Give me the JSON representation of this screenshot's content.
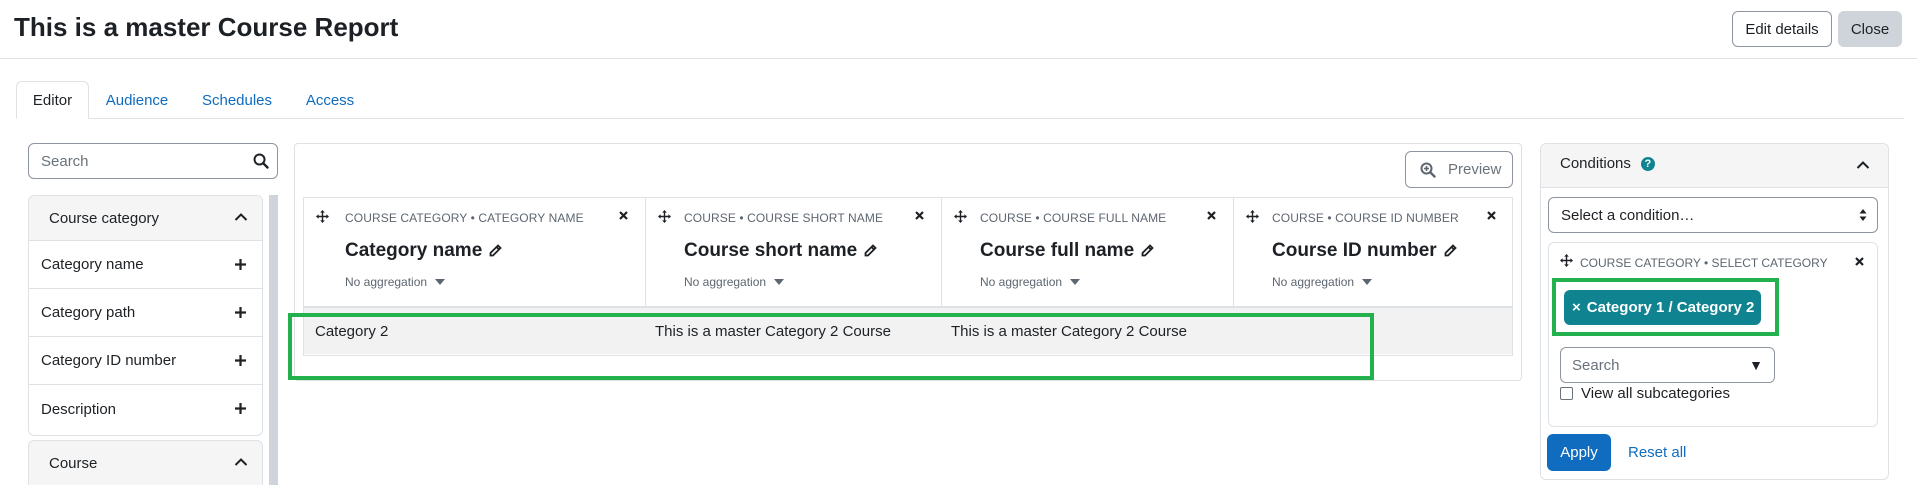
{
  "header": {
    "title": "This is a master Course Report",
    "edit_details_label": "Edit details",
    "close_label": "Close"
  },
  "tabs": [
    {
      "label": "Editor",
      "active": true
    },
    {
      "label": "Audience",
      "active": false
    },
    {
      "label": "Schedules",
      "active": false
    },
    {
      "label": "Access",
      "active": false
    }
  ],
  "sidebar": {
    "search_placeholder": "Search",
    "groups": [
      {
        "title": "Course category",
        "expanded": true,
        "items": [
          {
            "label": "Category name"
          },
          {
            "label": "Category path"
          },
          {
            "label": "Category ID number"
          },
          {
            "label": "Description"
          }
        ]
      },
      {
        "title": "Course",
        "expanded": true
      }
    ]
  },
  "report": {
    "preview_label": "Preview",
    "columns": [
      {
        "context": "COURSE CATEGORY • CATEGORY NAME",
        "name": "Category name",
        "aggregation": "No aggregation"
      },
      {
        "context": "COURSE • COURSE SHORT NAME",
        "name": "Course short name",
        "aggregation": "No aggregation"
      },
      {
        "context": "COURSE • COURSE FULL NAME",
        "name": "Course full name",
        "aggregation": "No aggregation"
      },
      {
        "context": "COURSE • COURSE ID NUMBER",
        "name": "Course ID number",
        "aggregation": "No aggregation"
      }
    ],
    "rows": [
      [
        "Category 2",
        "This is a master Category 2 Course",
        "This is a master Category 2 Course",
        ""
      ]
    ]
  },
  "conditions": {
    "title": "Conditions",
    "select_placeholder": "Select a condition…",
    "items": [
      {
        "context": "COURSE CATEGORY • SELECT CATEGORY",
        "selected": [
          "Category 1 / Category 2"
        ],
        "chip_remove": "×",
        "search_placeholder": "Search",
        "search_caret": "▼",
        "subcategories_label": "View all subcategories"
      }
    ],
    "apply_label": "Apply",
    "reset_label": "Reset all"
  },
  "colors": {
    "link": "#0f6cbf",
    "chip": "#0f8390",
    "highlight": "#23b14d",
    "apply": "#0f6cbf"
  }
}
